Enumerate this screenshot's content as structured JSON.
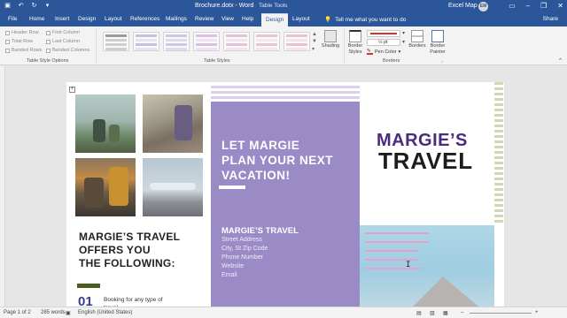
{
  "window": {
    "doc_title": "Brochure.dotx - Word",
    "context_title": "Table Tools",
    "user_name": "Excel Map",
    "user_initials": "EM"
  },
  "tabs": [
    {
      "label": "File"
    },
    {
      "label": "Home"
    },
    {
      "label": "Insert"
    },
    {
      "label": "Design"
    },
    {
      "label": "Layout"
    },
    {
      "label": "References"
    },
    {
      "label": "Mailings"
    },
    {
      "label": "Review"
    },
    {
      "label": "View"
    },
    {
      "label": "Help"
    },
    {
      "label": "Design"
    },
    {
      "label": "Layout"
    }
  ],
  "tellme": "Tell me what you want to do",
  "share": "Share",
  "ribbon": {
    "style_options": [
      "Header Row",
      "First Column",
      "Total Row",
      "Last Column",
      "Banded Rows",
      "Banded Columns"
    ],
    "group_table_style_options": "Table Style Options",
    "group_table_styles": "Table Styles",
    "shading": "Shading",
    "border_styles": "Border Styles",
    "pen_weight": "½ pt",
    "pen_color": "Pen Color",
    "borders": "Borders",
    "border_painter": "Border Painter",
    "group_borders": "Borders"
  },
  "document": {
    "offers": [
      "MARGIE’S TRAVEL",
      "OFFERS YOU",
      "THE FOLLOWING:"
    ],
    "item_number": "01",
    "item_text": "Booking for any type of travel",
    "panel_heading": [
      "LET MARGIE",
      "PLAN YOUR NEXT",
      "VACATION!"
    ],
    "address_title": "MARGIE’S TRAVEL",
    "address_lines": [
      "Street Address",
      "City, St Zip Code",
      "Phone Number",
      "Website",
      "Email"
    ],
    "brand_line1": "MARGIE’S",
    "brand_line2": "TRAVEL"
  },
  "status": {
    "page": "Page 1 of 2",
    "words": "285 words",
    "language": "English (United States)"
  },
  "colors": {
    "word_blue": "#2b579a",
    "purple_panel": "#9a8ac6",
    "brand_purple": "#4a2c7c",
    "olive": "#4b5a1f"
  }
}
